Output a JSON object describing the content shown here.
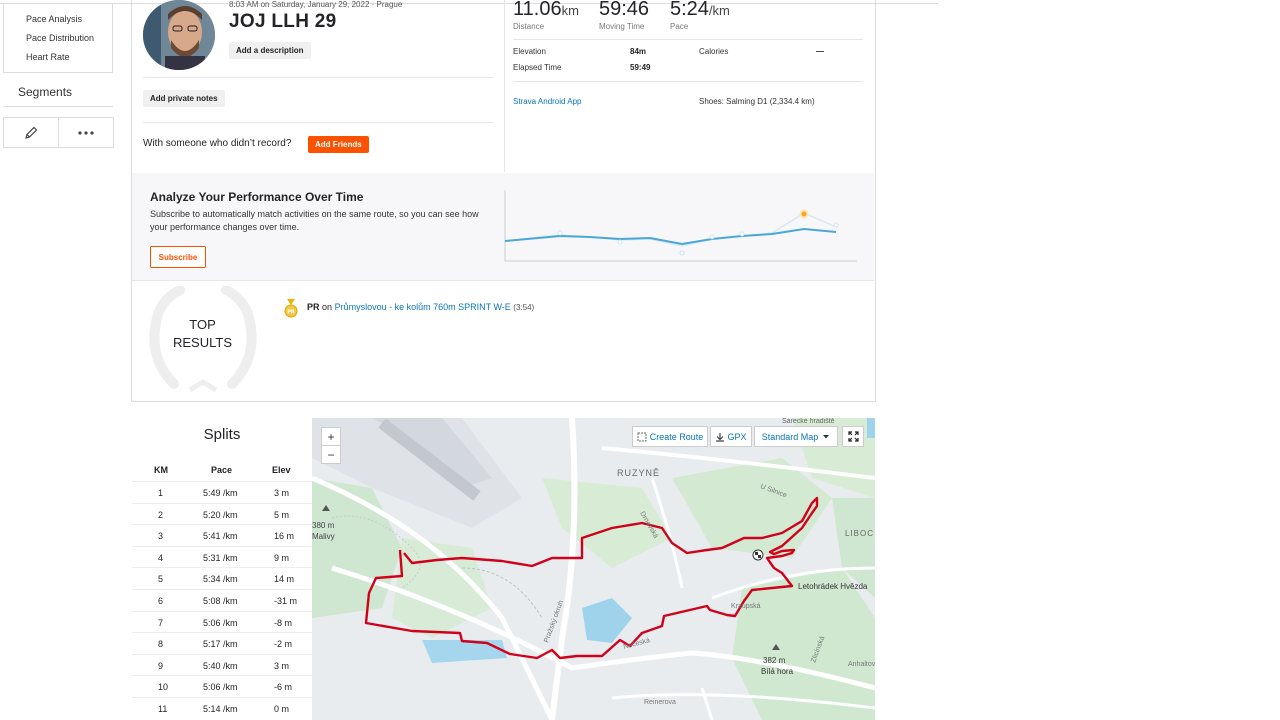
{
  "nav": {
    "items": [
      "Pace Analysis",
      "Pace Distribution",
      "Heart Rate"
    ],
    "segments": "Segments"
  },
  "activity": {
    "date": "8:03 AM on Saturday, January 29, 2022 · Prague",
    "title": "JOJ LLH 29",
    "add_description": "Add a description",
    "add_private_notes": "Add private notes",
    "with_someone": "With someone who didn’t record?",
    "add_friends": "Add Friends"
  },
  "stats": {
    "distance": {
      "value": "11.06",
      "unit": "km",
      "label": "Distance"
    },
    "moving_time": {
      "value": "59:46",
      "label": "Moving Time"
    },
    "pace": {
      "value": "5:24",
      "unit": "/km",
      "label": "Pace"
    },
    "elevation": {
      "label": "Elevation",
      "value": "84m"
    },
    "calories": {
      "label": "Calories",
      "value": "—"
    },
    "elapsed": {
      "label": "Elapsed Time",
      "value": "59:49"
    },
    "app": "Strava Android App",
    "shoes": "Shoes: Salming D1 (2,334.4 km)"
  },
  "analyze": {
    "title": "Analyze Your Performance Over Time",
    "desc": "Subscribe to automatically match activities on the same route, so you can see how your performance changes over time.",
    "subscribe": "Subscribe"
  },
  "results": {
    "top_line1": "TOP",
    "top_line2": "RESULTS",
    "pr_label": "PR",
    "pr_on": "on",
    "segment": "Průmyslovou - ke kolům 760m SPRINT W-E",
    "time": "(3:54)"
  },
  "splits": {
    "title": "Splits",
    "headers": [
      "KM",
      "Pace",
      "Elev"
    ],
    "pace_unit": "/km",
    "elev_unit": "m",
    "rows": [
      {
        "km": "1",
        "pace": "5:49",
        "elev": "3"
      },
      {
        "km": "2",
        "pace": "5:20",
        "elev": "5"
      },
      {
        "km": "3",
        "pace": "5:41",
        "elev": "16"
      },
      {
        "km": "4",
        "pace": "5:31",
        "elev": "9"
      },
      {
        "km": "5",
        "pace": "5:34",
        "elev": "14"
      },
      {
        "km": "6",
        "pace": "5:08",
        "elev": "-31"
      },
      {
        "km": "7",
        "pace": "5:06",
        "elev": "-8"
      },
      {
        "km": "8",
        "pace": "5:17",
        "elev": "-2"
      },
      {
        "km": "9",
        "pace": "5:40",
        "elev": "3"
      },
      {
        "km": "10",
        "pace": "5:06",
        "elev": "-6"
      },
      {
        "km": "11",
        "pace": "5:14",
        "elev": "0"
      }
    ]
  },
  "map": {
    "zoom_in": "+",
    "zoom_out": "−",
    "create_route": "Create Route",
    "gpx": "GPX",
    "map_type": "Standard Map",
    "labels": {
      "ruzyne": "RUZYNĚ",
      "malivy": "380 m\nMalivy",
      "letohradek": "Letohrádek Hvězda",
      "bila_hora": "382 m\nBílá hora",
      "sarecke": "Šárecké hradiště",
      "libo": "LIBOC",
      "u_silnice": "U Silnice",
      "drnovska": "Drnovská",
      "prazsky_okruh": "Pražský okruh",
      "krasnicka": "Kraupská",
      "neslovska": "Nečeská",
      "reinerova": "Reinerova",
      "zlicinska": "Zlicínská",
      "anhaltova": "Anhaltova",
      "r6": "6"
    }
  },
  "colors": {
    "accent": "#fc5200",
    "link": "#0a74b8",
    "route": "#d0021b",
    "trend": "#4aa7d6"
  }
}
